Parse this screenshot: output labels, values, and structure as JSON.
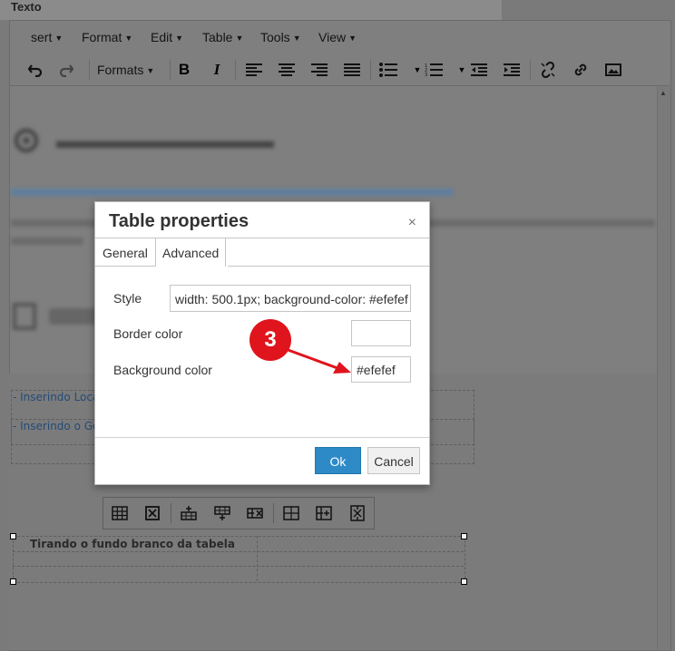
{
  "page": {
    "label": "Texto"
  },
  "menubar": {
    "items": [
      {
        "label": "sert"
      },
      {
        "label": "Format"
      },
      {
        "label": "Edit"
      },
      {
        "label": "Table"
      },
      {
        "label": "Tools"
      },
      {
        "label": "View"
      }
    ]
  },
  "toolbar": {
    "formats_label": "Formats",
    "icons": [
      "undo-icon",
      "redo-icon",
      "bold-icon",
      "italic-icon",
      "align-left-icon",
      "align-center-icon",
      "align-right-icon",
      "align-justify-icon",
      "bullet-list-icon",
      "numbered-list-icon",
      "outdent-icon",
      "indent-icon",
      "unlink-icon",
      "link-icon",
      "image-icon"
    ]
  },
  "content": {
    "list_item_1": "- Inserindo Loca",
    "list_item_2": "- Inserindo o Go",
    "table_caption": "Tirando o fundo branco da tabela"
  },
  "dialog": {
    "title": "Table properties",
    "close": "×",
    "tabs": [
      {
        "label": "General"
      },
      {
        "label": "Advanced"
      }
    ],
    "active_tab": "Advanced",
    "fields": {
      "style_label": "Style",
      "style_value": "width: 500.1px; background-color: #efefef",
      "border_color_label": "Border color",
      "border_color_value": "",
      "background_color_label": "Background color",
      "background_color_value": "#efefef"
    },
    "ok_label": "Ok",
    "cancel_label": "Cancel"
  },
  "annotation": {
    "step": "3"
  },
  "colors": {
    "accent": "#2d8ac7",
    "annotation_red": "#e0141c",
    "overlay": "#7a7a7a"
  }
}
